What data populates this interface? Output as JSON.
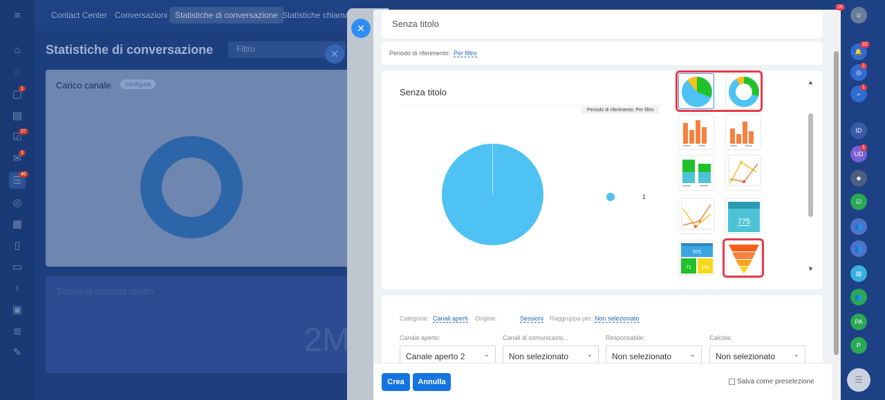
{
  "left_sidebar": {
    "badges": [
      "1",
      "37",
      "3",
      "40"
    ]
  },
  "top_nav": {
    "items": [
      "Contact Center",
      "Conversazioni",
      "Statistiche di conversazione",
      "Statistiche chiamate"
    ]
  },
  "background": {
    "page_title": "Statistiche di conversazione",
    "filter_placeholder": "Filtro",
    "card1_title": "Carico canale",
    "card1_badge": "configura",
    "card2_title": "Tempo di risposta medio",
    "card2_value": "2M"
  },
  "modal": {
    "title_value": "Senza titolo",
    "period_label": "Periodo di riferimento:",
    "period_value": "Per filtro",
    "preview": {
      "title": "Senza titolo",
      "period_tag": "Periodo di riferimento: Per filtro",
      "legend_value": "1"
    },
    "chart_types": [
      {
        "icon": "pie-chart-icon",
        "selected": true
      },
      {
        "icon": "donut-chart-icon"
      },
      {
        "icon": "bar-chart-icon"
      },
      {
        "icon": "bar-chart-date-icon"
      },
      {
        "icon": "stacked-bar-icon"
      },
      {
        "icon": "line-chart-icon"
      },
      {
        "icon": "line-chart-compare-icon"
      },
      {
        "icon": "number-block-icon",
        "value": "775"
      },
      {
        "icon": "multi-number-block-icon",
        "values": [
          "975",
          "71",
          "105"
        ]
      },
      {
        "icon": "funnel-chart-icon"
      }
    ],
    "settings": {
      "category_label": "Categoria:",
      "category_value": "Canali aperti",
      "origin_label": "Origine:",
      "origin_value": "Sessioni",
      "group_label": "Raggruppa per:",
      "group_value": "Non selezionato",
      "selects": [
        {
          "label": "Canale aperto:",
          "value": "Canale aperto 2"
        },
        {
          "label": "Canali di comunicazio...",
          "value": "Non selezionato"
        },
        {
          "label": "Responsabile:",
          "value": "Non selezionato"
        },
        {
          "label": "Calcola:",
          "value": "Non selezionato"
        }
      ]
    },
    "footer": {
      "create_label": "Crea",
      "cancel_label": "Annulla",
      "save_preset_label": "Salva come preselezione"
    }
  },
  "right_sidebar": {
    "badges": [
      "22",
      "1",
      "1",
      "1"
    ],
    "initials": [
      "ID",
      "UD",
      "PA",
      "P"
    ],
    "top_badge": "16"
  },
  "colors": {
    "accent": "#1574e0",
    "pie": "#4fc2f4",
    "highlight": "#e53a4a",
    "bar": "#f6813f"
  }
}
